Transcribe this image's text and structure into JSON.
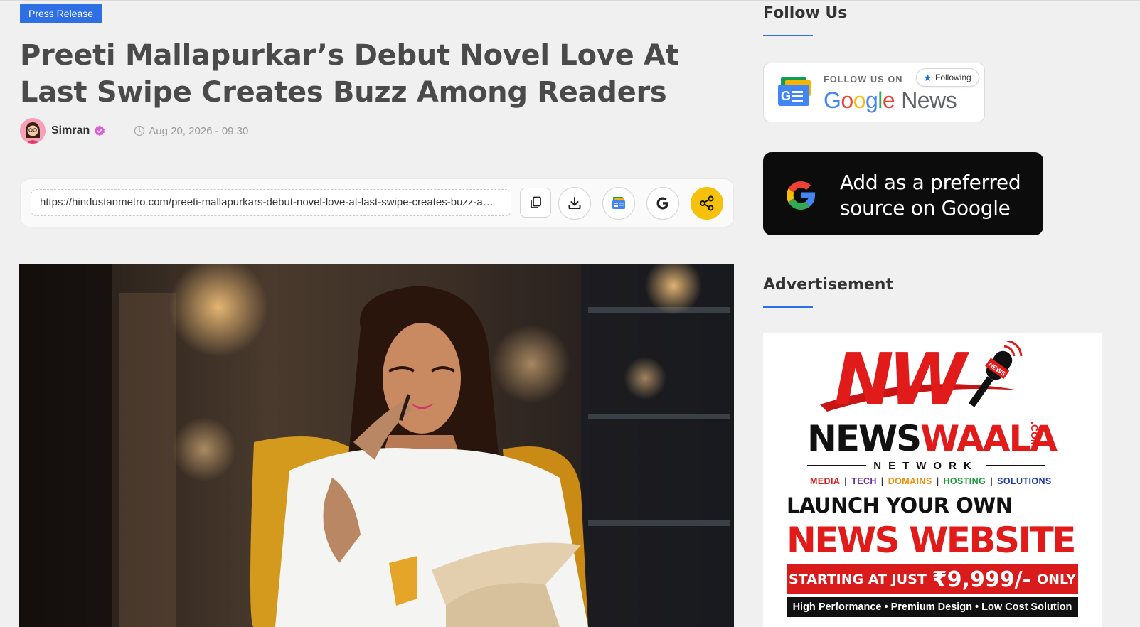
{
  "article": {
    "category": "Press Release",
    "title": "Preeti Mallapurkar’s Debut Novel Love At Last Swipe Creates Buzz Among Readers",
    "author": "Simran",
    "date": "Aug 20, 2026 - 09:30"
  },
  "share": {
    "url": "https://hindustanmetro.com/preeti-mallapurkars-debut-novel-love-at-last-swipe-creates-buzz-among-readers/",
    "icons": [
      "copy-icon",
      "download-icon",
      "google-news-icon",
      "google-icon",
      "share-icon"
    ]
  },
  "sidebar": {
    "follow_title": "Follow Us",
    "google_news": {
      "follow_label": "FOLLOW US ON",
      "brand_google": "Google",
      "brand_news": "News",
      "pill": "Following"
    },
    "preferred_source": "Add as a preferred source on Google",
    "ad_title": "Advertisement",
    "ad": {
      "logo": "NW",
      "mic_badge": "NEWS",
      "brand_a": "NEWS",
      "brand_b": "WAALA",
      "brand_tld": ".COM",
      "network": "NETWORK",
      "services": [
        "MEDIA",
        "TECH",
        "DOMAINS",
        "HOSTING",
        "SOLUTIONS"
      ],
      "launch": "LAUNCH YOUR OWN",
      "website": "NEWS WEBSITE",
      "price_prefix": "STARTING AT JUST",
      "price": "₹9,999/-",
      "price_suffix": "ONLY",
      "features": "High Performance • Premium Design • Low Cost Solution"
    }
  },
  "colors": {
    "accent": "#2f6fe6",
    "share_button": "#f5c10a",
    "ad_red": "#e11a1a",
    "services": [
      "#d91b1b",
      "#6b2bb5",
      "#f08a00",
      "#1a9a3a",
      "#1a3aa8"
    ]
  }
}
